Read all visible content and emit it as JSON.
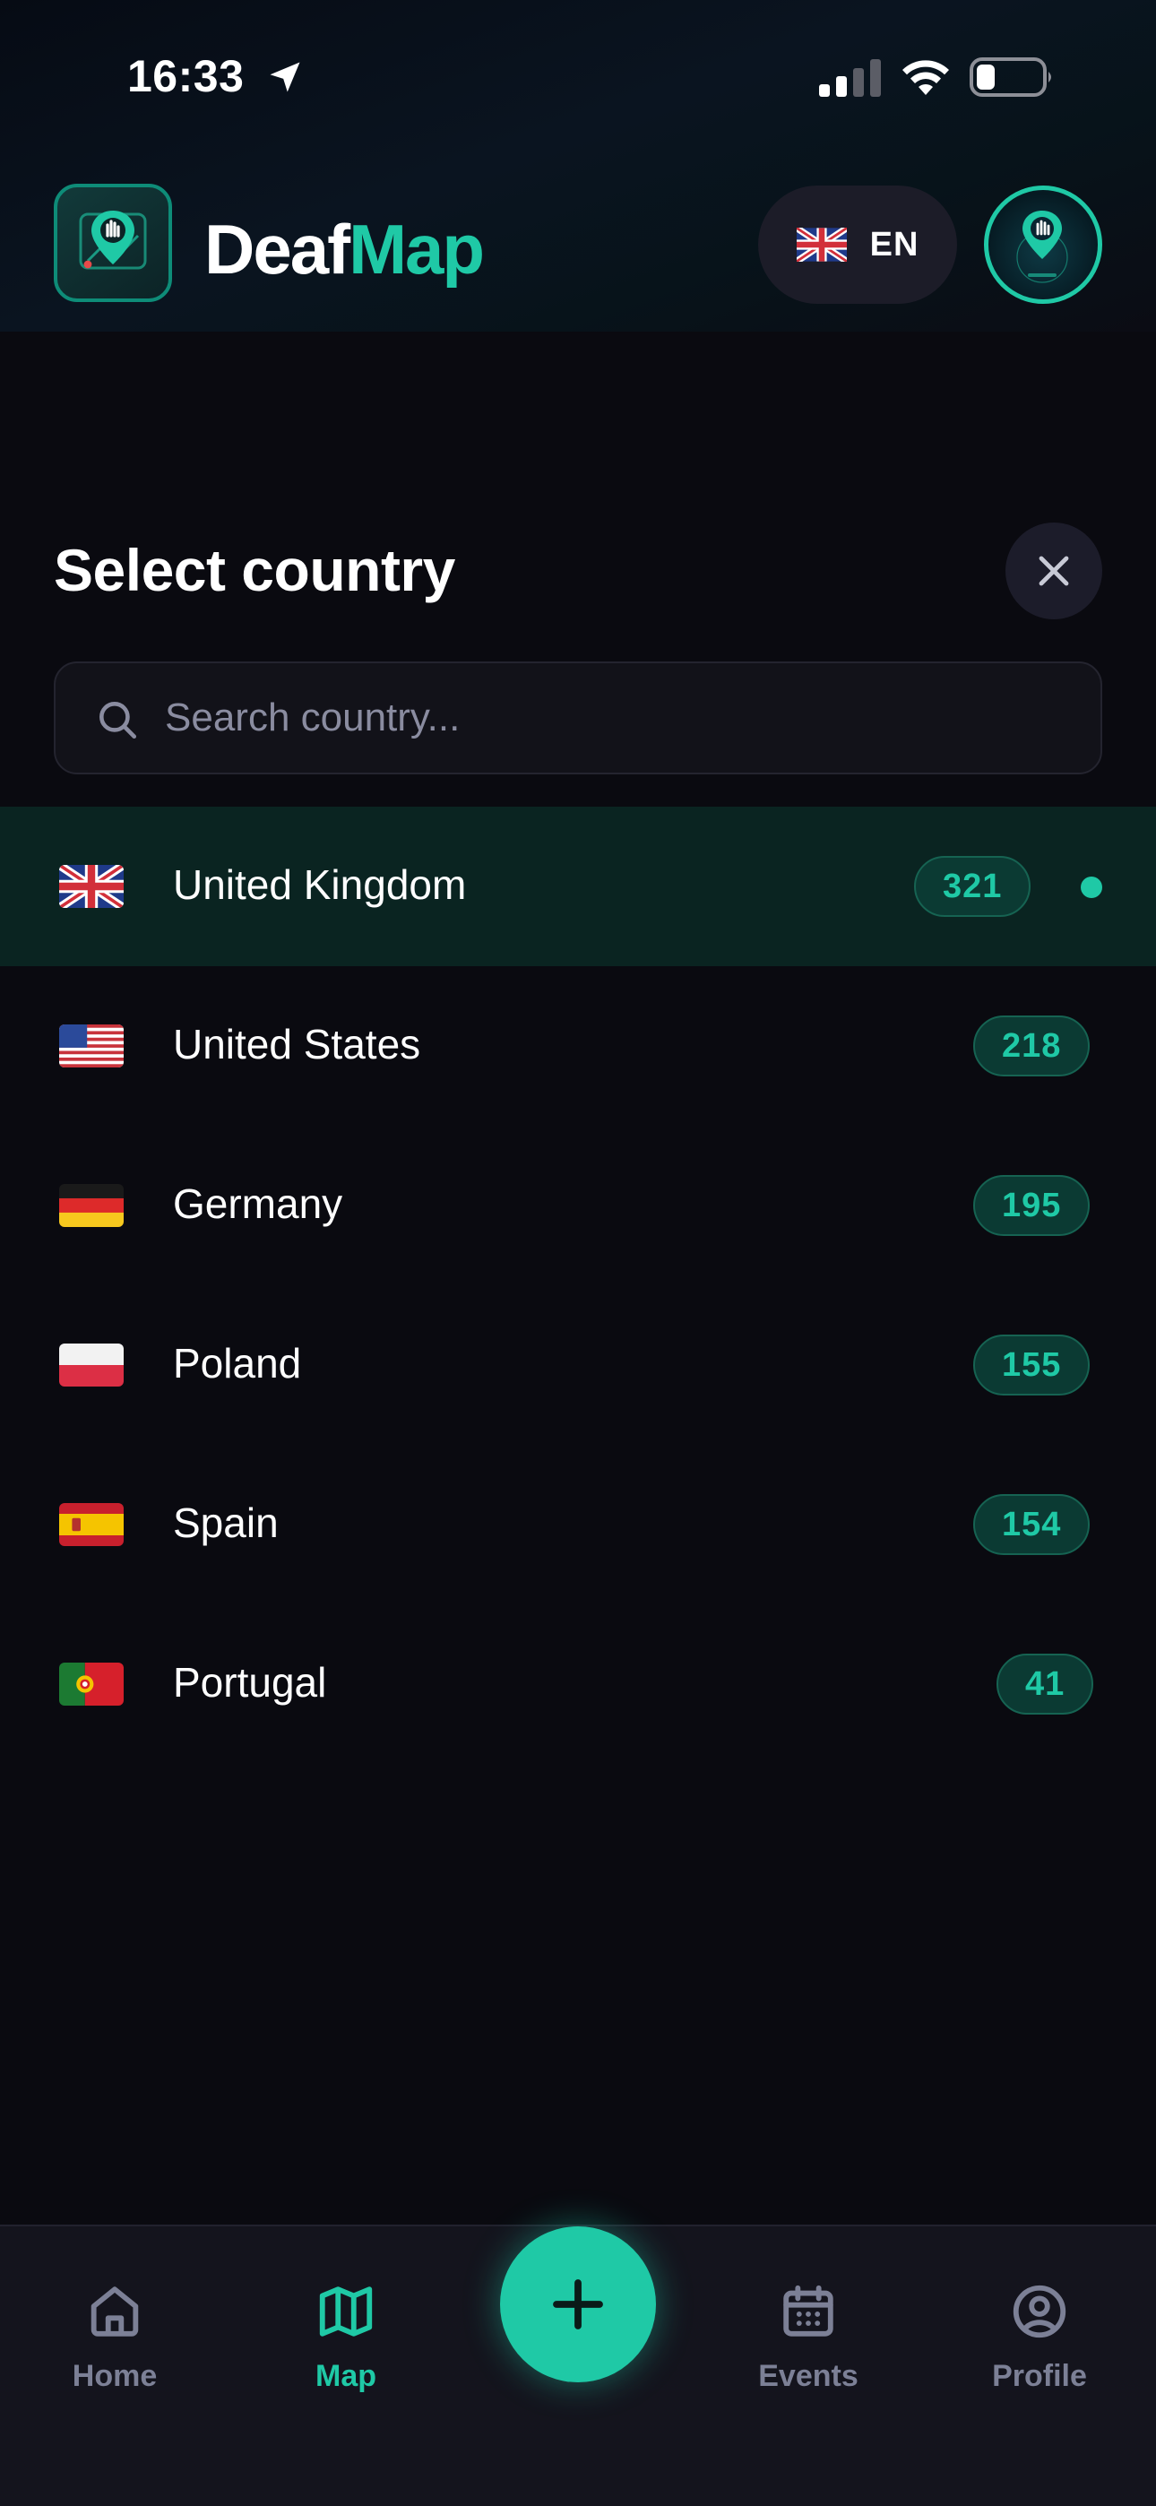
{
  "status_bar": {
    "time": "16:33"
  },
  "header": {
    "brand_part1": "Deaf",
    "brand_part2": "Map",
    "language_code": "EN"
  },
  "sheet": {
    "title": "Select country",
    "search_placeholder": "Search country..."
  },
  "countries": [
    {
      "name": "United Kingdom",
      "count": "321",
      "selected": true
    },
    {
      "name": "United States",
      "count": "218",
      "selected": false
    },
    {
      "name": "Germany",
      "count": "195",
      "selected": false
    },
    {
      "name": "Poland",
      "count": "155",
      "selected": false
    },
    {
      "name": "Spain",
      "count": "154",
      "selected": false
    },
    {
      "name": "Portugal",
      "count": "41",
      "selected": false
    }
  ],
  "tabs": [
    {
      "label": "Home",
      "icon": "home-icon",
      "active": false
    },
    {
      "label": "Map",
      "icon": "map-icon",
      "active": true
    },
    {
      "label": "Events",
      "icon": "calendar-icon",
      "active": false
    },
    {
      "label": "Profile",
      "icon": "user-circle-icon",
      "active": false
    }
  ],
  "colors": {
    "accent": "#1fc9a6",
    "background": "#0a0a10",
    "selected_row": "#0a2421"
  }
}
